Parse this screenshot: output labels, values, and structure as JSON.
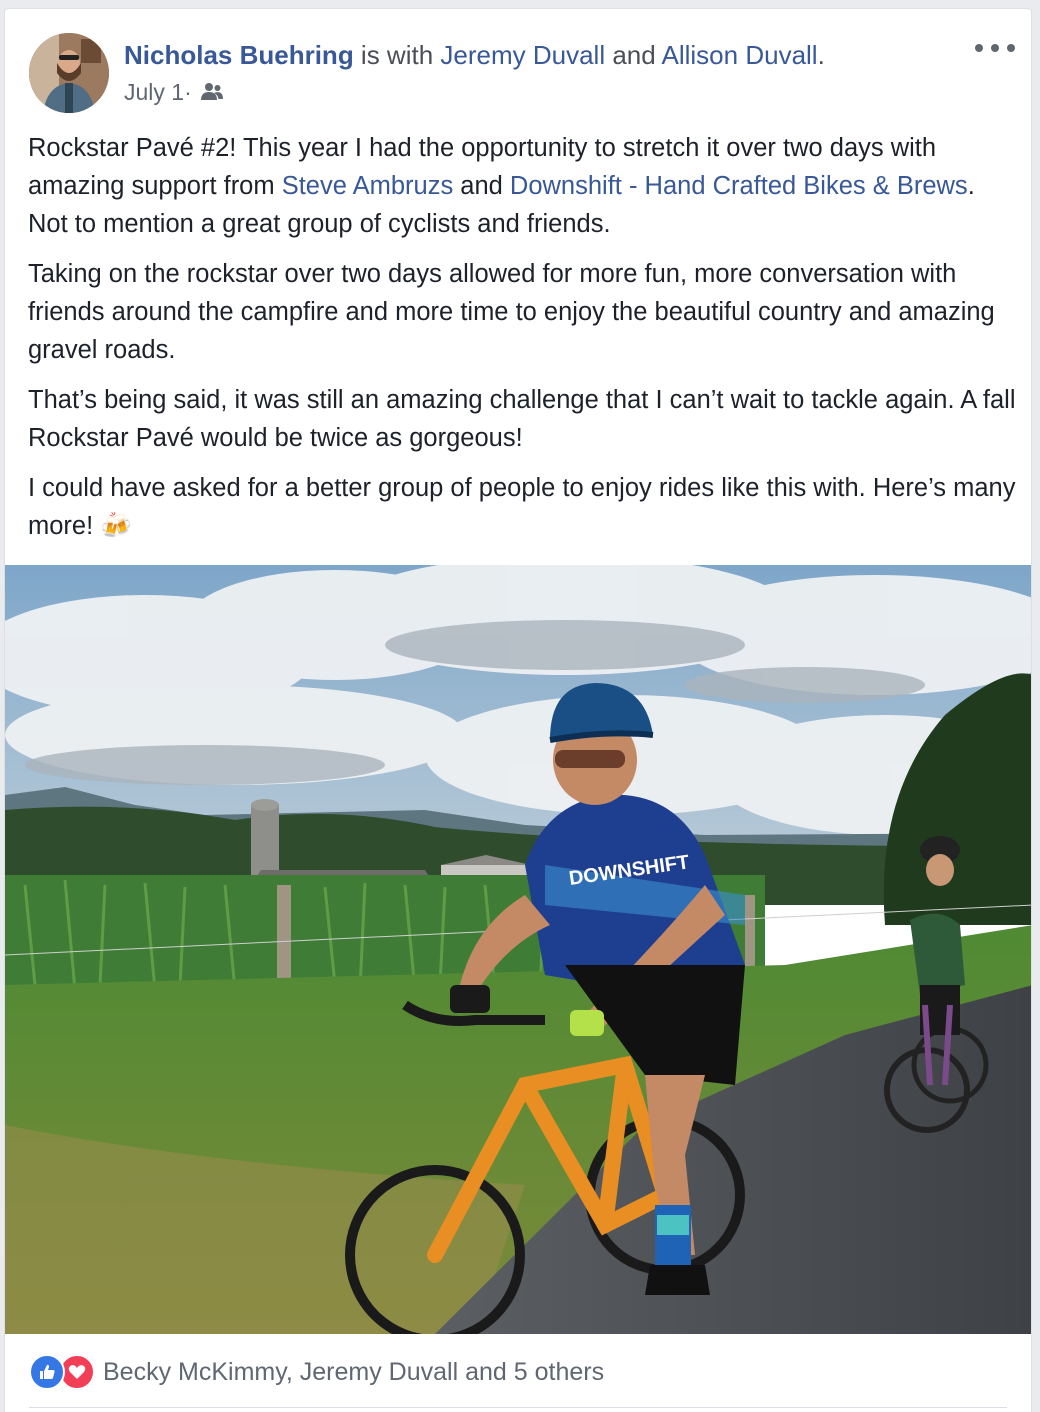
{
  "post": {
    "author": "Nicholas Buehring",
    "with_text": " is with ",
    "tagged_1": "Jeremy Duvall",
    "and_text": " and ",
    "tagged_2": "Allison Duvall",
    "end_text": ".",
    "date": "July 1",
    "date_sep": " · ",
    "privacy_icon": "friends-icon",
    "paragraphs": {
      "p1_a": "Rockstar Pavé #2! This year I had the opportunity to stretch it over two days with amazing support from ",
      "p1_link1": "Steve Ambruzs",
      "p1_b": " and ",
      "p1_link2": "Downshift - Hand Crafted Bikes & Brews",
      "p1_c": ". Not to mention a great group of cyclists and friends.",
      "p2": "Taking on the rockstar over two days allowed for more fun, more conversation with friends around the campfire and more time to enjoy the beautiful country and amazing gravel roads.",
      "p3": "That’s being said, it was still an amazing challenge that I can’t wait to tackle again. A fall Rockstar Pavé would be twice as gorgeous!",
      "p4": "I could have asked for a better group of people to enjoy rides like this with. Here’s many more! ",
      "p4_emoji": "🍻"
    },
    "photo_jersey_text": "DOWNSHIFT",
    "reactions": {
      "icons": [
        "like-icon",
        "love-icon"
      ],
      "text": "Becky McKimmy, Jeremy Duvall and 5 others"
    }
  },
  "colors": {
    "link": "#385898",
    "like": "#3578e5",
    "love": "#f33e58",
    "meta": "#616770"
  }
}
